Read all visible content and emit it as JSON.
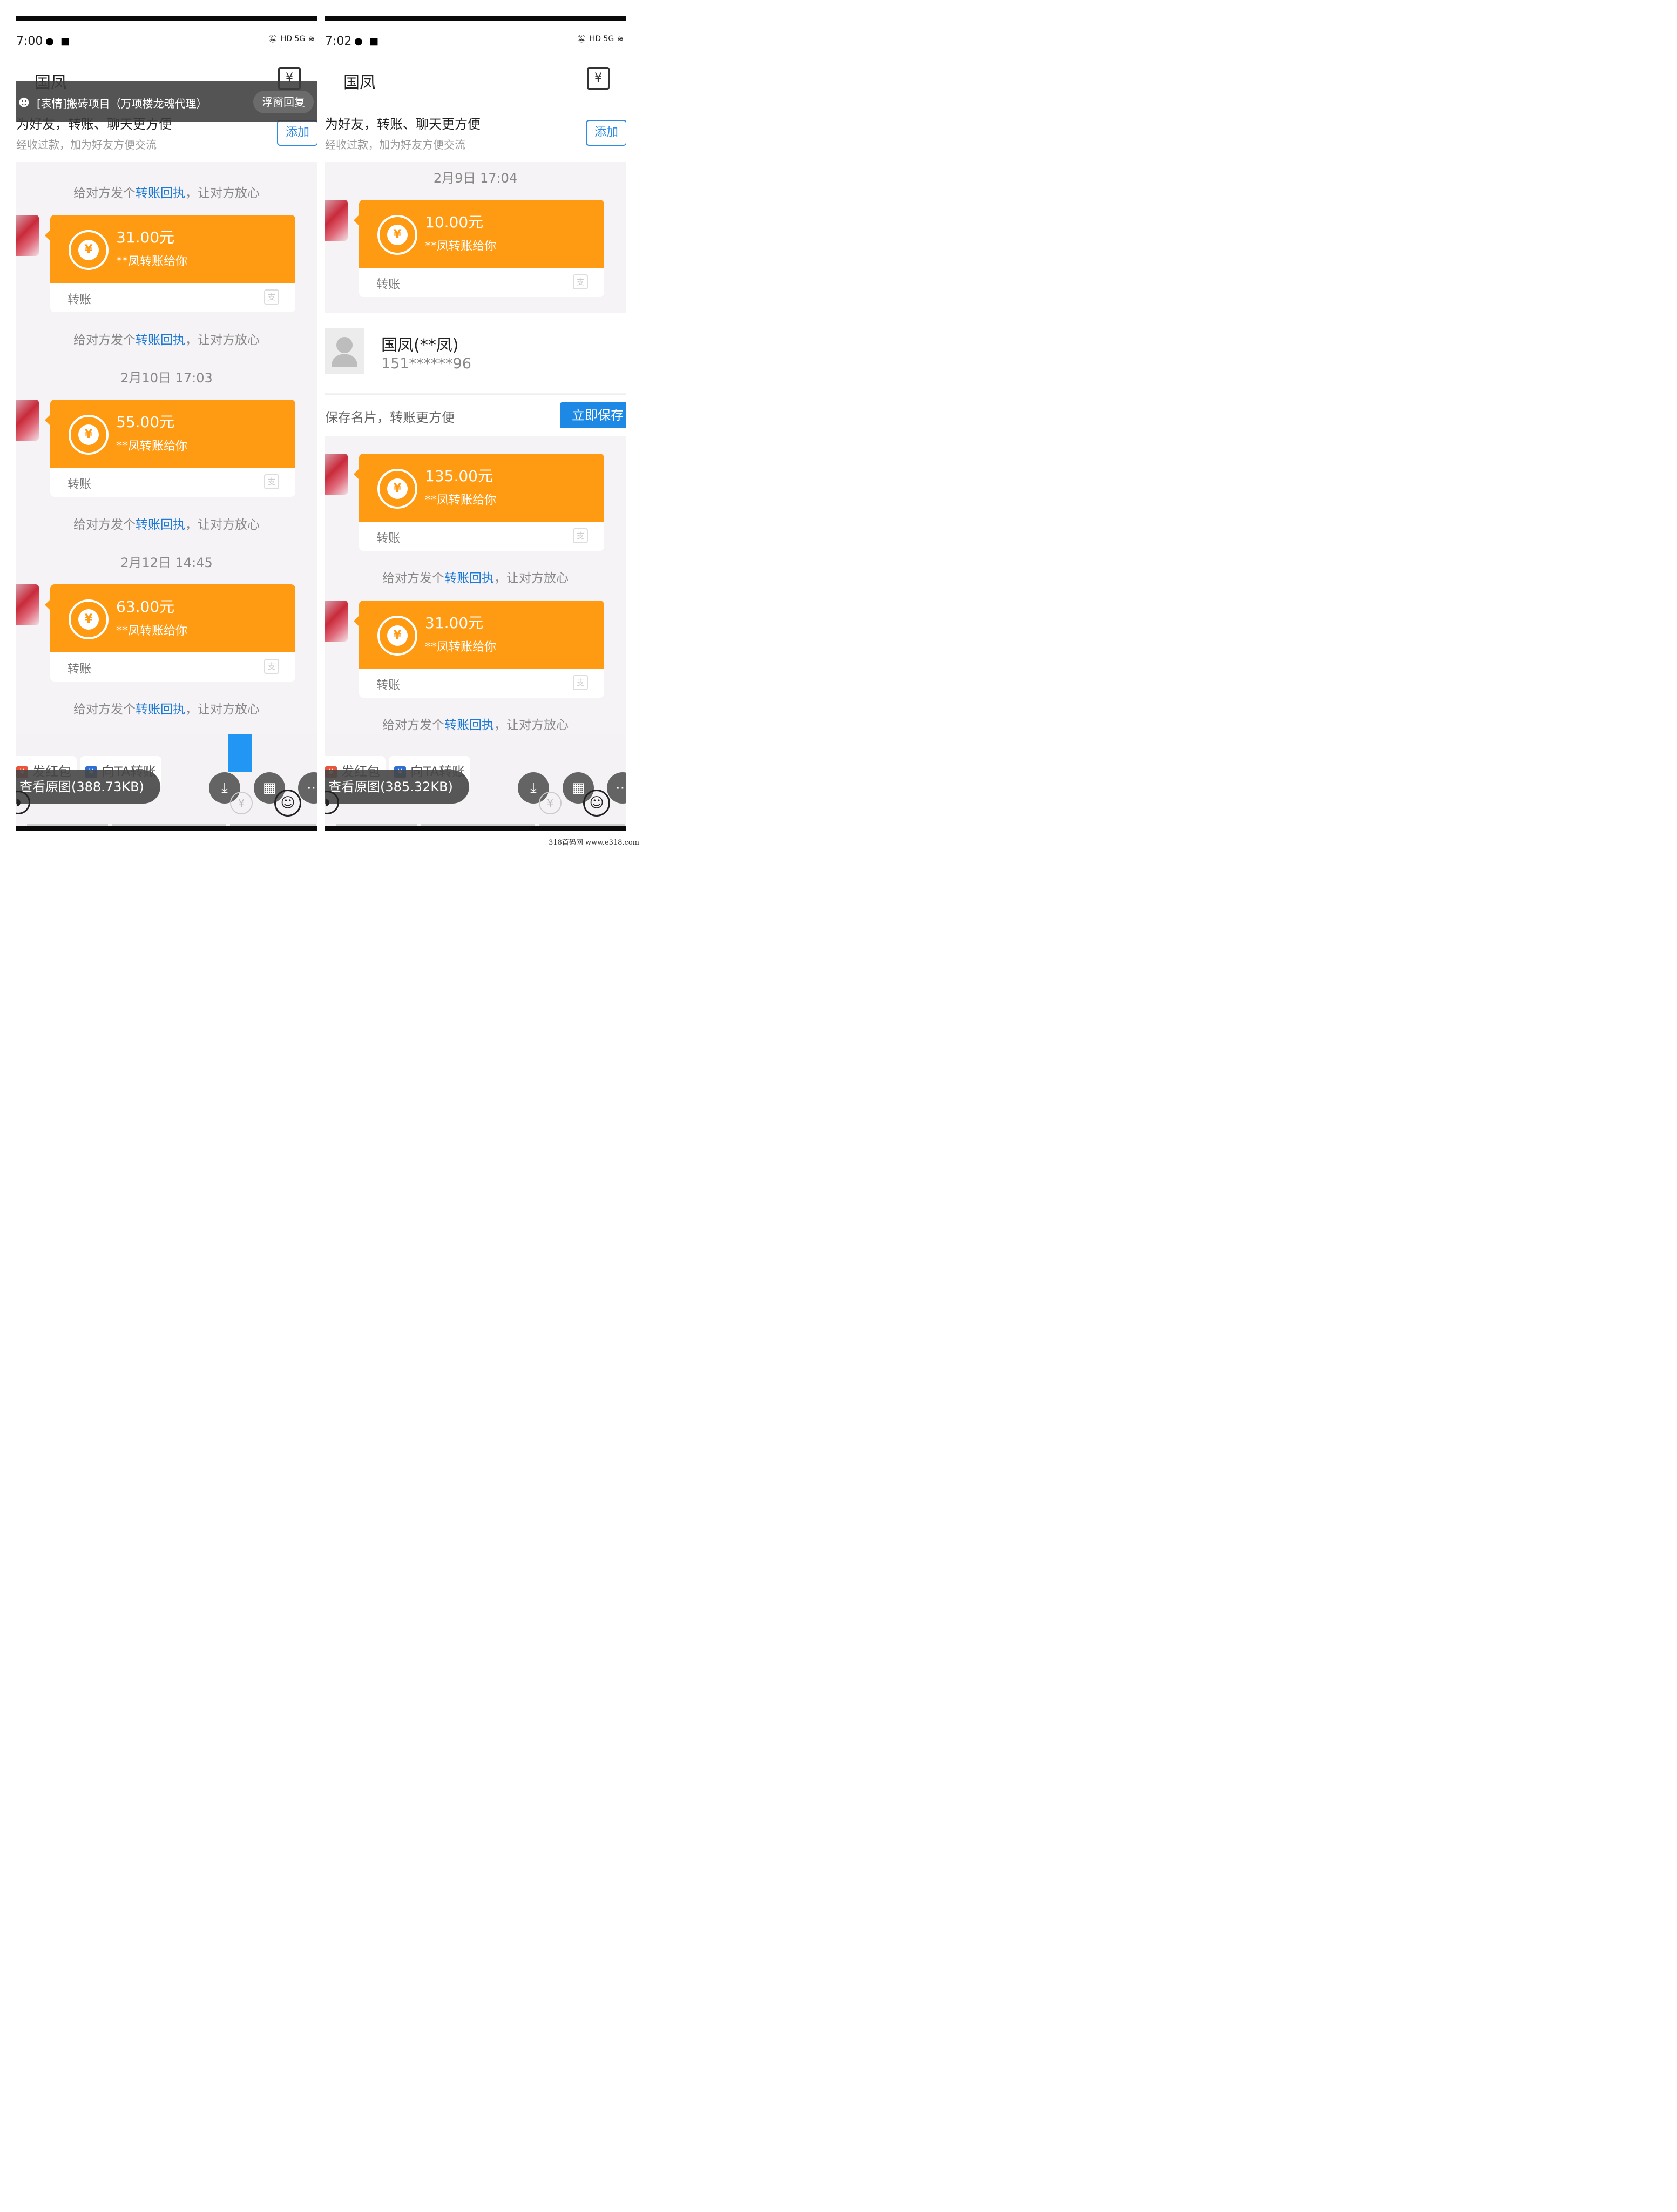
{
  "left": {
    "status": {
      "time": "7:00",
      "right_icons": "HD 5G"
    },
    "header": {
      "title": "国凤"
    },
    "float_notification": {
      "text": "[表情]搬砖项目（万项楼龙魂代理）",
      "button": "浮窗回复"
    },
    "banner": {
      "line1": "为好友，转账、聊天更方便",
      "line2": "经收过款，加为好友方便交流",
      "add_button": "添加"
    },
    "hint_prefix": "给对方发个",
    "hint_link": "转账回执",
    "hint_suffix": "，让对方放心",
    "dates": [
      "2月10日 17:03",
      "2月12日 14:45"
    ],
    "transfers": [
      {
        "amount": "31.00元",
        "from": "**凤转账给你",
        "label": "转账"
      },
      {
        "amount": "55.00元",
        "from": "**凤转账给你",
        "label": "转账"
      },
      {
        "amount": "63.00元",
        "from": "**凤转账给你",
        "label": "转账"
      }
    ],
    "bottom": {
      "chip_red": "发红包",
      "chip_transfer": "向TA转账",
      "view_original": "查看原图(388.73KB)"
    }
  },
  "right": {
    "status": {
      "time": "7:02",
      "right_icons": "HD 5G"
    },
    "header": {
      "title": "国凤"
    },
    "banner": {
      "line1": "为好友，转账、聊天更方便",
      "line2": "经收过款，加为好友方便交流",
      "add_button": "添加"
    },
    "hint_prefix": "给对方发个",
    "hint_link": "转账回执",
    "hint_suffix": "，让对方放心",
    "dates": [
      "2月9日 17:04"
    ],
    "transfers": [
      {
        "amount": "10.00元",
        "from": "**凤转账给你",
        "label": "转账"
      },
      {
        "amount": "135.00元",
        "from": "**凤转账给你",
        "label": "转账"
      },
      {
        "amount": "31.00元",
        "from": "**凤转账给你",
        "label": "转账"
      }
    ],
    "contact": {
      "name": "国凤(**凤)",
      "phone": "151******96"
    },
    "save_bar": {
      "text": "保存名片，转账更方便",
      "button": "立即保存"
    },
    "bottom": {
      "chip_red": "发红包",
      "chip_transfer": "向TA转账",
      "view_original": "查看原图(385.32KB)"
    }
  },
  "watermark": "318首码网   www.e318.com",
  "colors": {
    "orange": "#ff9b13",
    "link_blue": "#1f7ad6",
    "button_blue": "#1e88e5"
  }
}
